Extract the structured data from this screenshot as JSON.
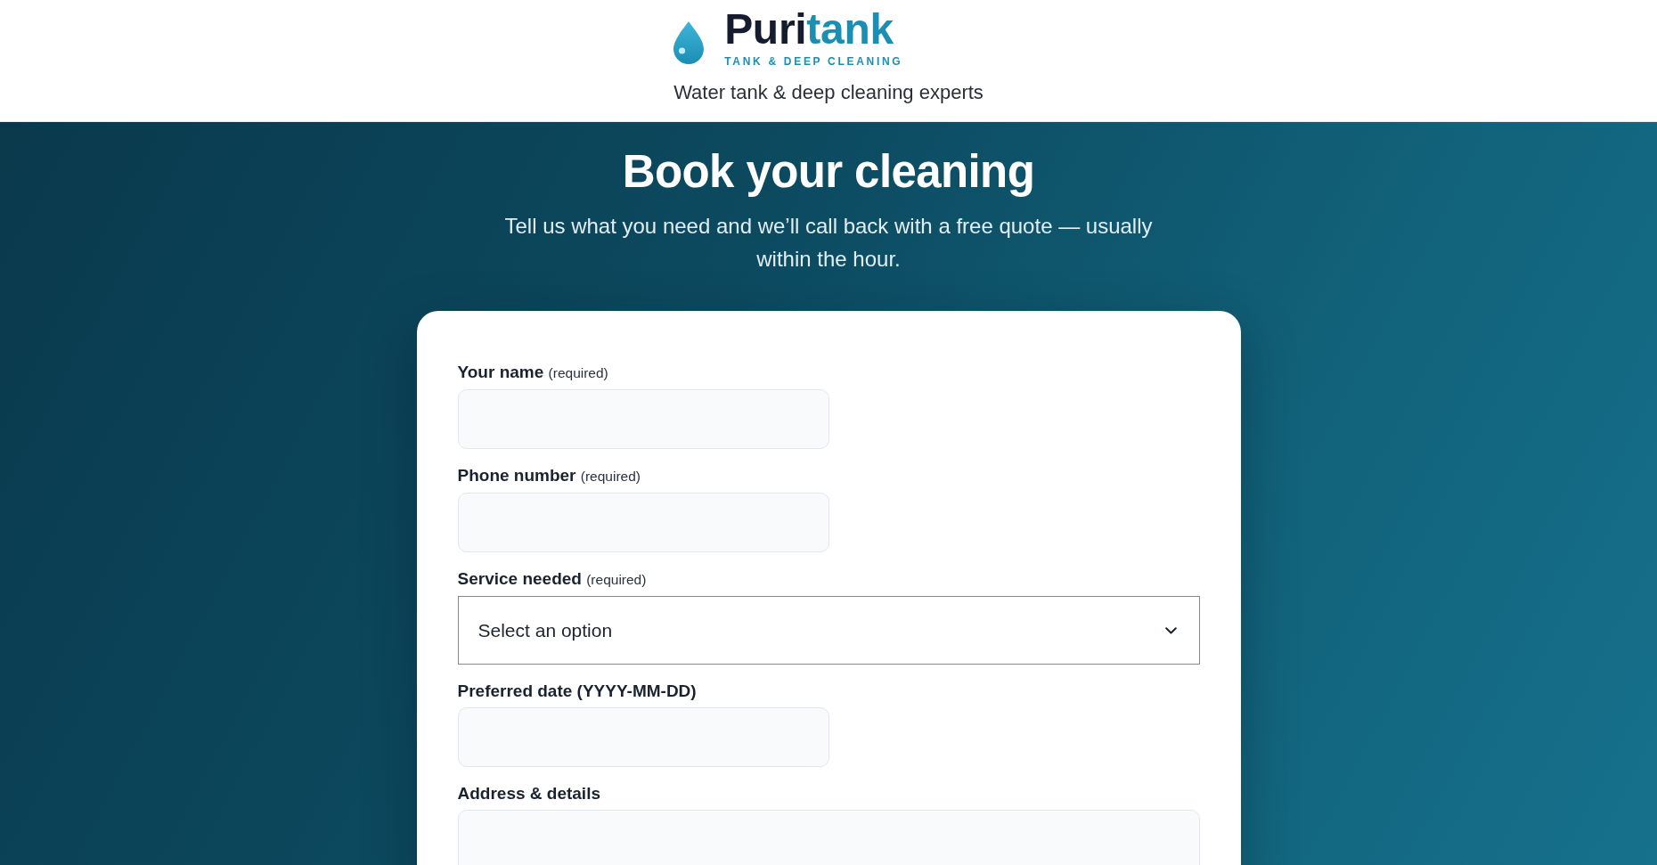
{
  "header": {
    "logo": {
      "wordmark": [
        {
          "text": "Puri",
          "color": "#141c2e"
        },
        {
          "text": "tank",
          "color": "#1b8fb3"
        }
      ],
      "slogan": "TANK & DEEP CLEANING"
    },
    "tagline": "Water tank & deep cleaning experts"
  },
  "hero": {
    "title": "Book your cleaning",
    "subtitle": "Tell us what you need and we’ll call back with a free quote — usually within the hour."
  },
  "form": {
    "fields": [
      {
        "kind": "input",
        "label": "Your name",
        "note": "(required)"
      },
      {
        "kind": "input",
        "label": "Phone number",
        "note": "(required)"
      },
      {
        "kind": "select",
        "label": "Service needed",
        "note": "(required)",
        "value": "Select an option"
      },
      {
        "kind": "input",
        "label": "Preferred date (YYYY-MM-DD)"
      },
      {
        "kind": "textarea",
        "label": "Address & details"
      }
    ]
  }
}
